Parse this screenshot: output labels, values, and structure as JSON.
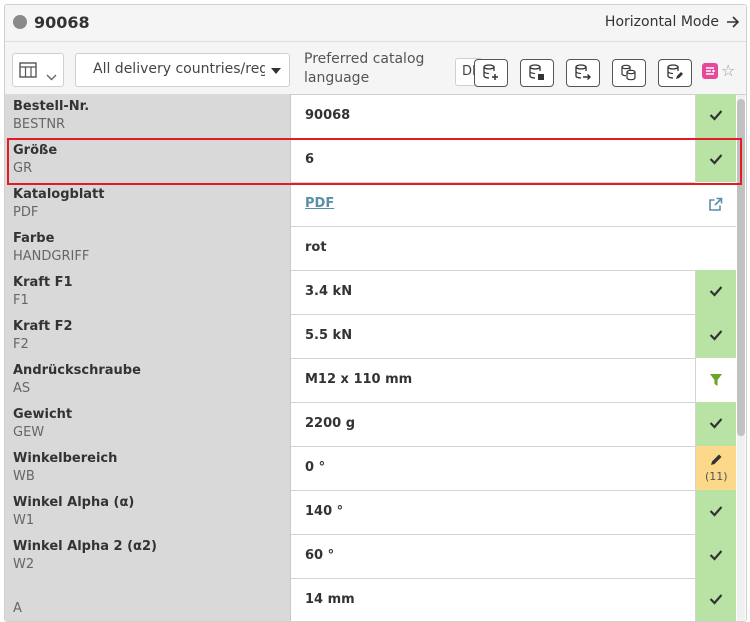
{
  "header": {
    "title": "90068",
    "mode_link": "Horizontal Mode"
  },
  "toolbar": {
    "country_select": "All delivery countries/regions",
    "lang_label": "Preferred catalog language",
    "lang_value": "DE",
    "buttons": [
      "database-add-icon",
      "database-remove-icon",
      "database-export-icon",
      "database-copy-icon",
      "database-edit-icon"
    ],
    "pink_color": "#e8489a"
  },
  "rows": [
    {
      "label": "Bestell-Nr.",
      "code": "BESTNR",
      "value": "90068",
      "status": "ok"
    },
    {
      "label": "Größe",
      "code": "GR",
      "value": "6",
      "status": "ok",
      "highlighted": true
    },
    {
      "label": "Katalogblatt",
      "code": "PDF",
      "value": "PDF",
      "status": "external-link"
    },
    {
      "label": "Farbe",
      "code": "HANDGRIFF",
      "value": "rot",
      "status": "none"
    },
    {
      "label": "Kraft F1",
      "code": "F1",
      "value": "3.4 kN",
      "status": "ok"
    },
    {
      "label": "Kraft F2",
      "code": "F2",
      "value": "5.5 kN",
      "status": "ok"
    },
    {
      "label": "Andrückschraube",
      "code": "AS",
      "value": "M12 x 110 mm",
      "status": "filter"
    },
    {
      "label": "Gewicht",
      "code": "GEW",
      "value": "2200 g",
      "status": "ok"
    },
    {
      "label": "Winkelbereich",
      "code": "WB",
      "value": "0 °",
      "status": "edit",
      "count": "(11)"
    },
    {
      "label": "Winkel Alpha (α)",
      "code": "W1",
      "value": "140 °",
      "status": "ok"
    },
    {
      "label": "Winkel Alpha 2 (α2)",
      "code": "W2",
      "value": "60 °",
      "status": "ok"
    },
    {
      "label": "",
      "code": "A",
      "value": "14 mm",
      "status": "ok"
    }
  ],
  "colors": {
    "ok": "#b9e3a4",
    "edit": "#fcd98a",
    "highlight": "#e31b23",
    "filter": "#6aa428"
  }
}
